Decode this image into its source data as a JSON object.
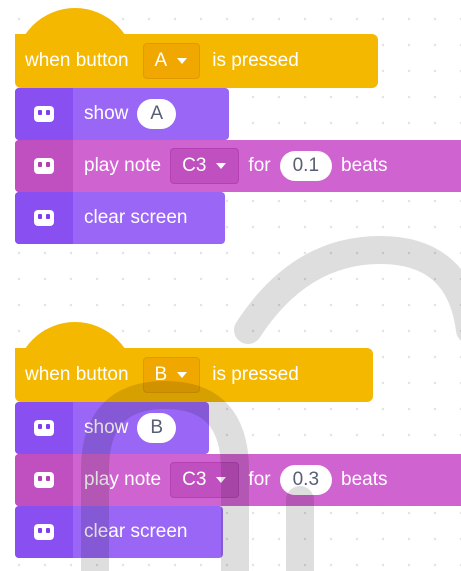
{
  "scripts": [
    {
      "hat": {
        "prefix": "when button",
        "button": "A",
        "suffix": "is pressed"
      },
      "show": {
        "label": "show",
        "value": "A"
      },
      "note": {
        "label": "play note",
        "note": "C3",
        "for_label": "for",
        "beats_value": "0.1",
        "beats_label": "beats"
      },
      "clear": {
        "label": "clear screen"
      }
    },
    {
      "hat": {
        "prefix": "when button",
        "button": "B",
        "suffix": "is pressed"
      },
      "show": {
        "label": "show",
        "value": "B"
      },
      "note": {
        "label": "play note",
        "note": "C3",
        "for_label": "for",
        "beats_value": "0.3",
        "beats_label": "beats"
      },
      "clear": {
        "label": "clear screen"
      }
    }
  ],
  "colors": {
    "event": "#f5b800",
    "display": "#9966f5",
    "music": "#cf63cf",
    "watermark": "#000000"
  },
  "icons": {
    "block_category": "robot-icon",
    "dropdown": "caret-down-icon"
  }
}
